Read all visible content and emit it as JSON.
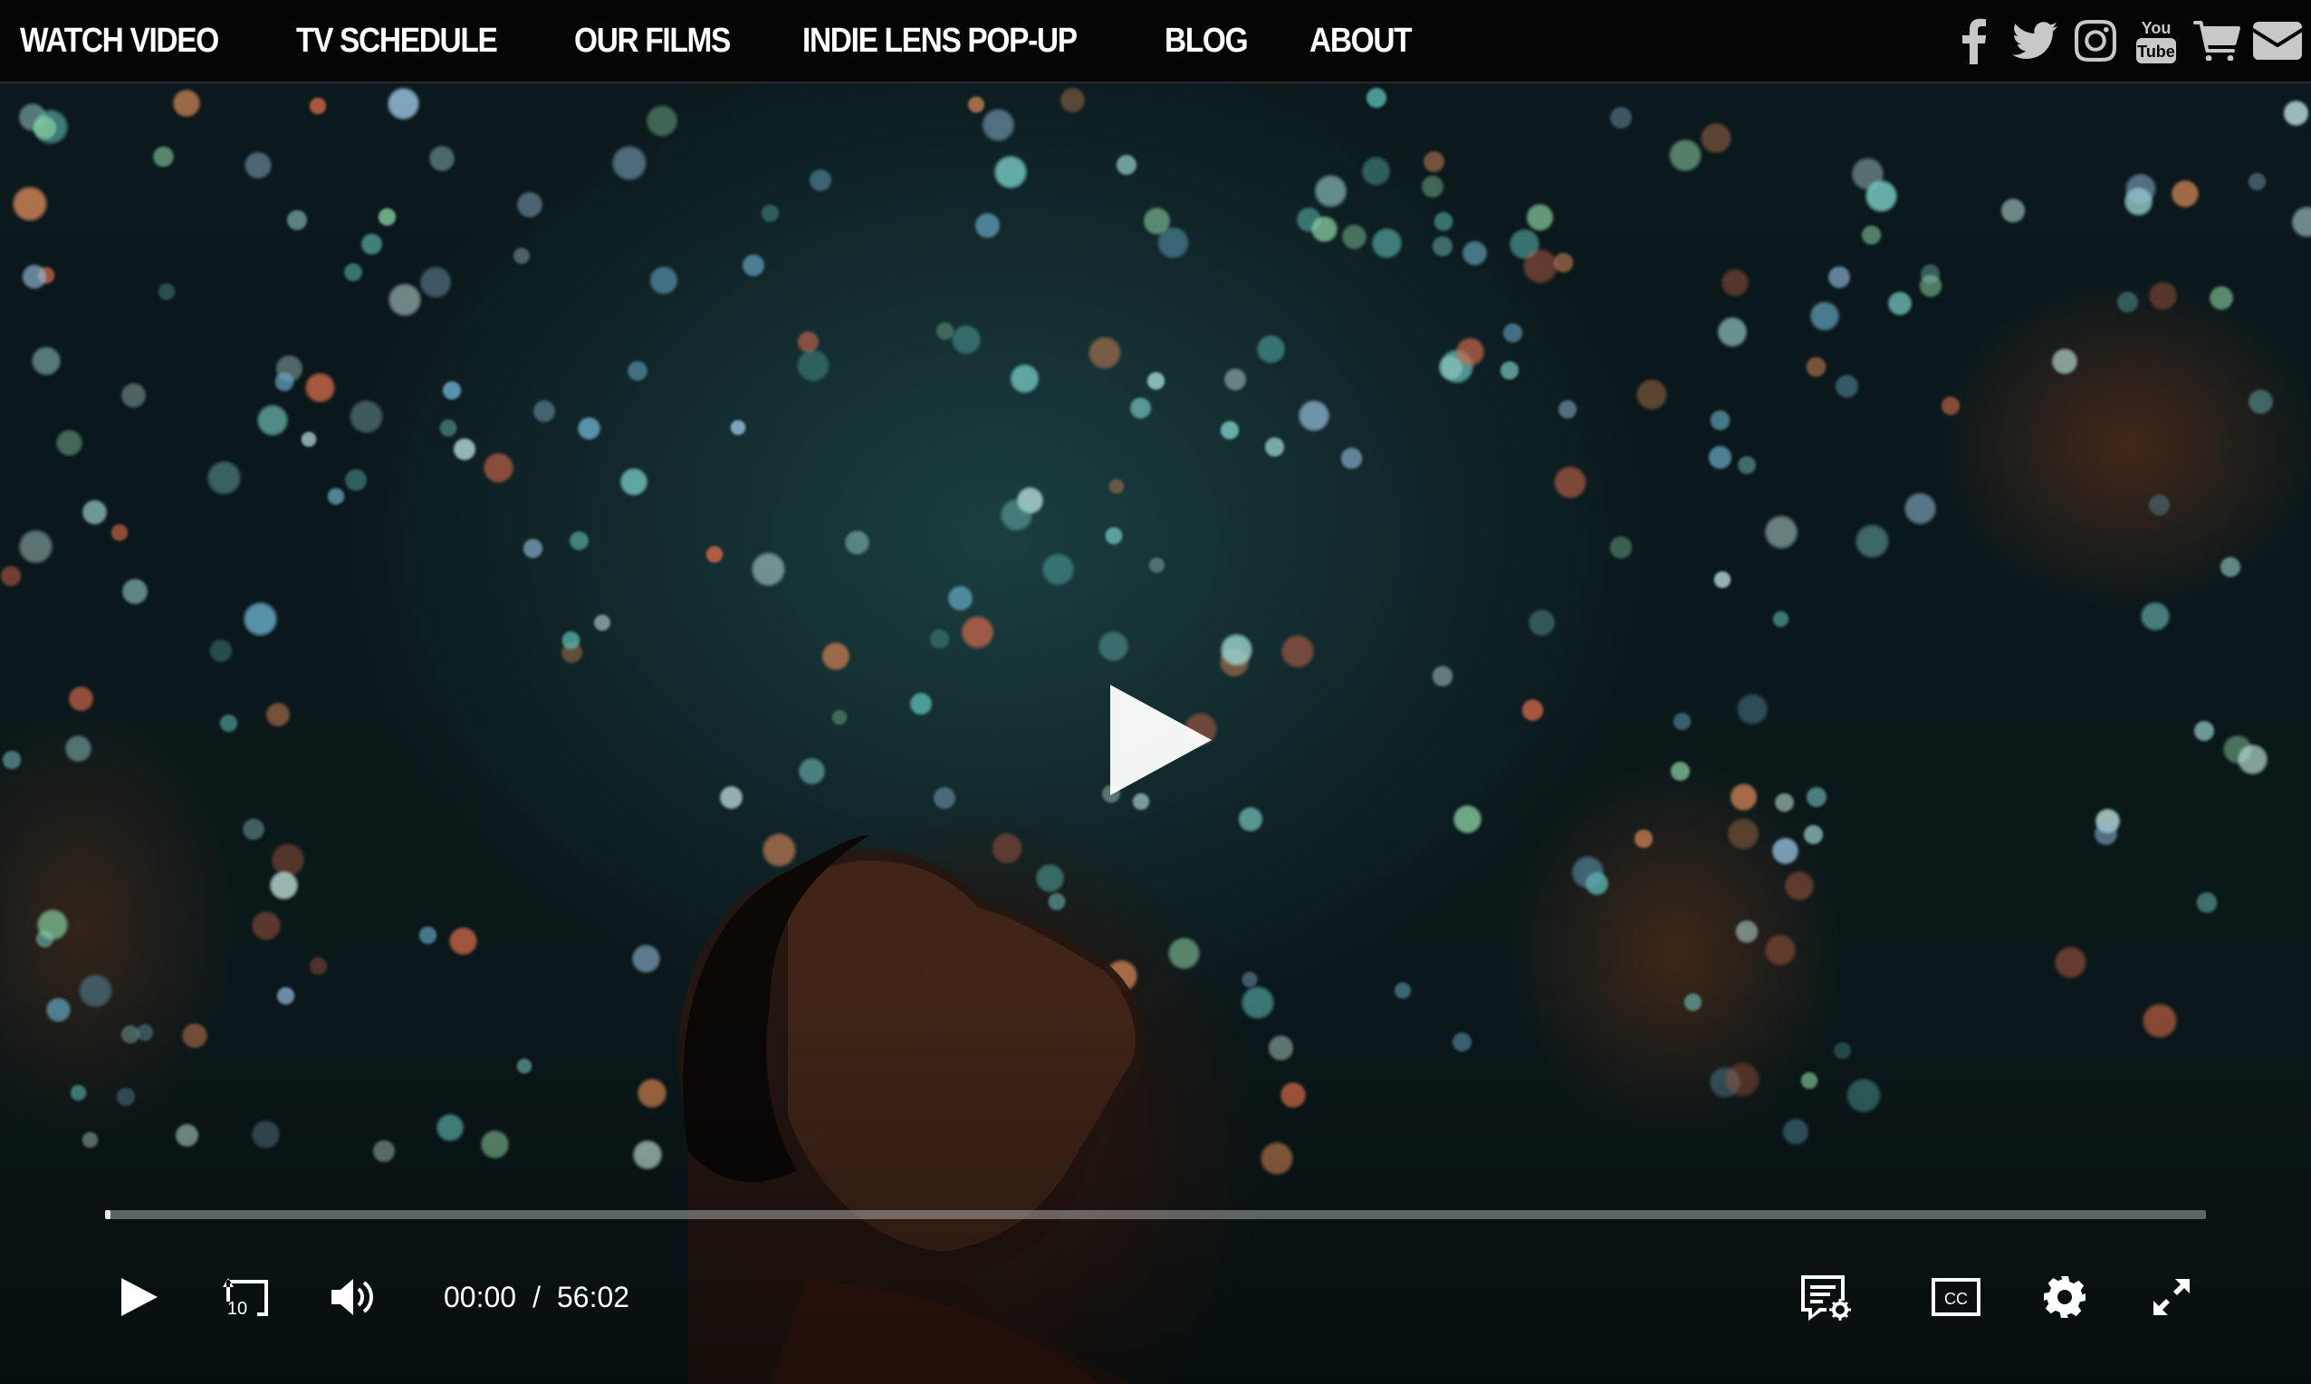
{
  "nav": {
    "items": [
      {
        "label": "WATCH VIDEO"
      },
      {
        "label": "TV SCHEDULE"
      },
      {
        "label": "OUR FILMS"
      },
      {
        "label": "INDIE LENS POP-UP"
      },
      {
        "label": "BLOG"
      },
      {
        "label": "ABOUT"
      }
    ]
  },
  "social": {
    "icons": [
      "facebook-icon",
      "twitter-icon",
      "instagram-icon",
      "youtube-icon",
      "shopping-cart-icon",
      "email-icon"
    ],
    "youtube_text": {
      "line1": "You",
      "line2": "Tube"
    }
  },
  "player": {
    "current_time": "00:00",
    "separator": "/",
    "duration": "56:02",
    "progress": 0,
    "skip_back_seconds": "10",
    "cc_label": "CC",
    "state": "paused",
    "icon_color": "#ffffff"
  }
}
